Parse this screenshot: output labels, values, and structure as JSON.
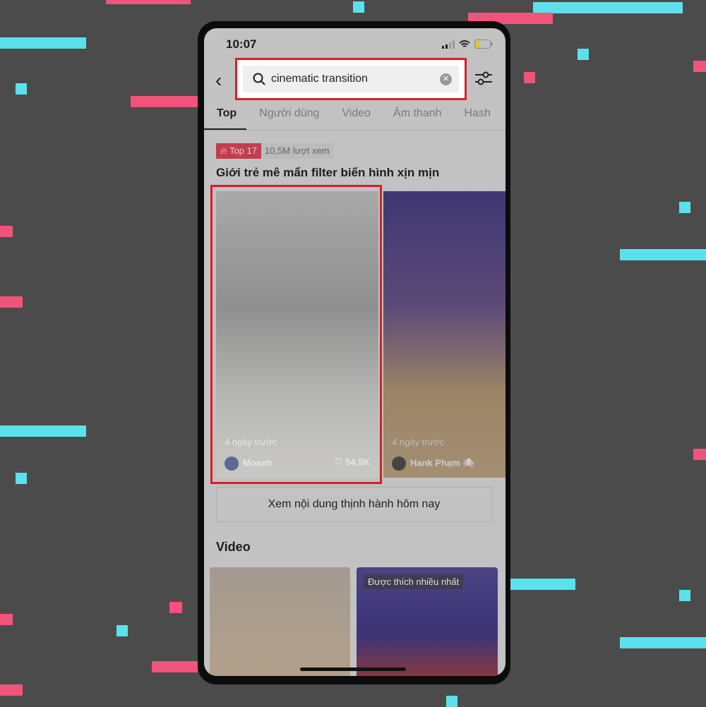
{
  "status_bar": {
    "time": "10:07"
  },
  "search": {
    "query": "cinematic transition"
  },
  "tabs": [
    {
      "label": "Top"
    },
    {
      "label": "Người dùng"
    },
    {
      "label": "Video"
    },
    {
      "label": "Âm thanh"
    },
    {
      "label": "Hash"
    }
  ],
  "trending": {
    "badge": "Top 17",
    "views": "10,5M lượt xem",
    "headline": "Giới trẻ mê mẩn filter biến hình xịn mịn"
  },
  "cards": [
    {
      "time": "4 ngày trước",
      "author": "Moanh",
      "likes": "54,5K"
    },
    {
      "time": "4 ngày trước",
      "author": "Hank Phạm",
      "likes": ""
    }
  ],
  "trend_button": "Xem nội dung thịnh hành hôm nay",
  "video_section": {
    "title": "Video",
    "liked_label": "Được thích nhiều nhất"
  },
  "colors": {
    "highlight": "#d5202a",
    "badge": "#c23d4f",
    "background": "#4b4b4b"
  }
}
